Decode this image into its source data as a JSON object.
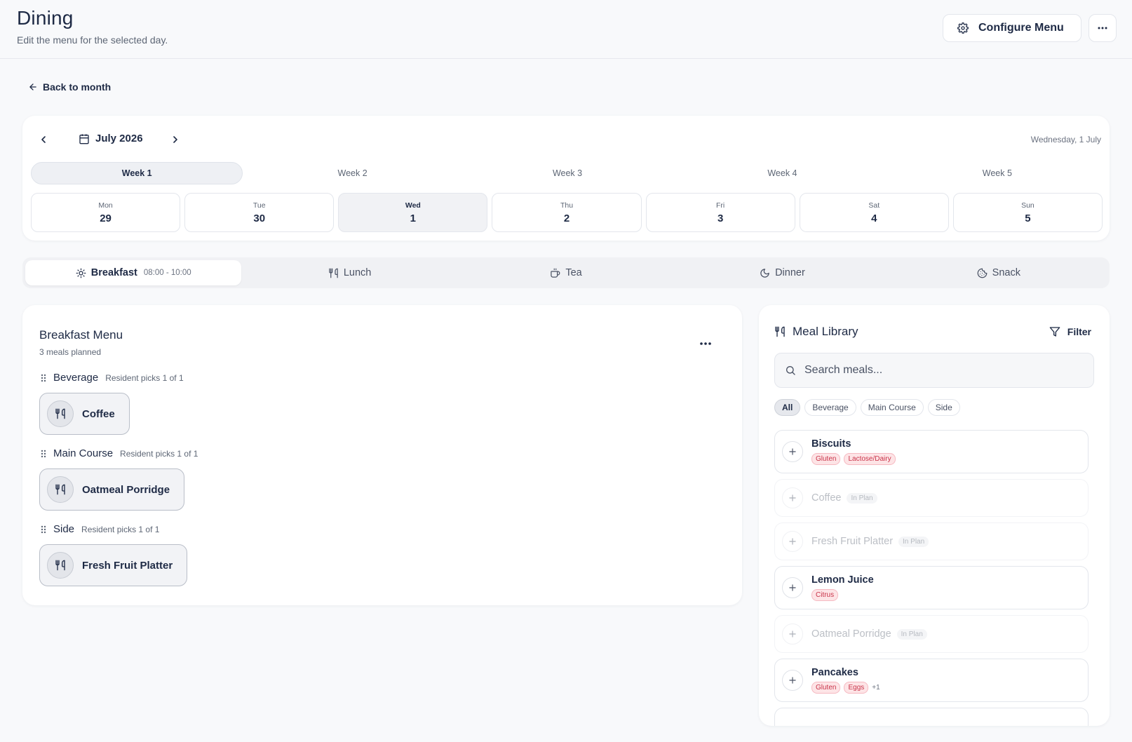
{
  "header": {
    "title": "Dining",
    "subtitle": "Edit the menu for the selected day.",
    "configure_label": "Configure Menu"
  },
  "back_label": "Back to month",
  "calendar": {
    "month_label": "July 2026",
    "selected_date": "Wednesday, 1 July",
    "weeks": [
      "Week 1",
      "Week 2",
      "Week 3",
      "Week 4",
      "Week 5"
    ],
    "active_week": 0,
    "days": [
      {
        "name": "Mon",
        "num": "29"
      },
      {
        "name": "Tue",
        "num": "30"
      },
      {
        "name": "Wed",
        "num": "1"
      },
      {
        "name": "Thu",
        "num": "2"
      },
      {
        "name": "Fri",
        "num": "3"
      },
      {
        "name": "Sat",
        "num": "4"
      },
      {
        "name": "Sun",
        "num": "5"
      }
    ],
    "active_day": 2
  },
  "meal_tabs": [
    {
      "label": "Breakfast",
      "time": "08:00 - 10:00",
      "icon": "sun-icon"
    },
    {
      "label": "Lunch",
      "time": "",
      "icon": "utensils-icon"
    },
    {
      "label": "Tea",
      "time": "",
      "icon": "cup-icon"
    },
    {
      "label": "Dinner",
      "time": "",
      "icon": "moon-icon"
    },
    {
      "label": "Snack",
      "time": "",
      "icon": "cookie-icon"
    }
  ],
  "menu": {
    "title": "Breakfast Menu",
    "subtitle": "3 meals planned",
    "groups": [
      {
        "name": "Beverage",
        "rule": "Resident picks 1 of 1",
        "meal": "Coffee"
      },
      {
        "name": "Main Course",
        "rule": "Resident picks 1 of 1",
        "meal": "Oatmeal Porridge"
      },
      {
        "name": "Side",
        "rule": "Resident picks 1 of 1",
        "meal": "Fresh Fruit Platter"
      }
    ]
  },
  "library": {
    "title": "Meal Library",
    "filter_label": "Filter",
    "search_placeholder": "Search meals...",
    "chips": [
      "All",
      "Beverage",
      "Main Course",
      "Side"
    ],
    "active_chip": 0,
    "in_plan_label": "In Plan",
    "items": [
      {
        "name": "Biscuits",
        "tags": [
          "Gluten",
          "Lactose/Dairy"
        ],
        "more": "",
        "in_plan": false
      },
      {
        "name": "Coffee",
        "tags": [],
        "more": "",
        "in_plan": true
      },
      {
        "name": "Fresh Fruit Platter",
        "tags": [],
        "more": "",
        "in_plan": true
      },
      {
        "name": "Lemon Juice",
        "tags": [
          "Citrus"
        ],
        "more": "",
        "in_plan": false
      },
      {
        "name": "Oatmeal Porridge",
        "tags": [],
        "more": "",
        "in_plan": true
      },
      {
        "name": "Pancakes",
        "tags": [
          "Gluten",
          "Eggs"
        ],
        "more": "+1",
        "in_plan": false
      }
    ]
  },
  "colors": {
    "text": "#1e2a45",
    "muted": "#5d6675",
    "allergen_bg": "#fde4e6",
    "allergen_text": "#c9344a"
  }
}
